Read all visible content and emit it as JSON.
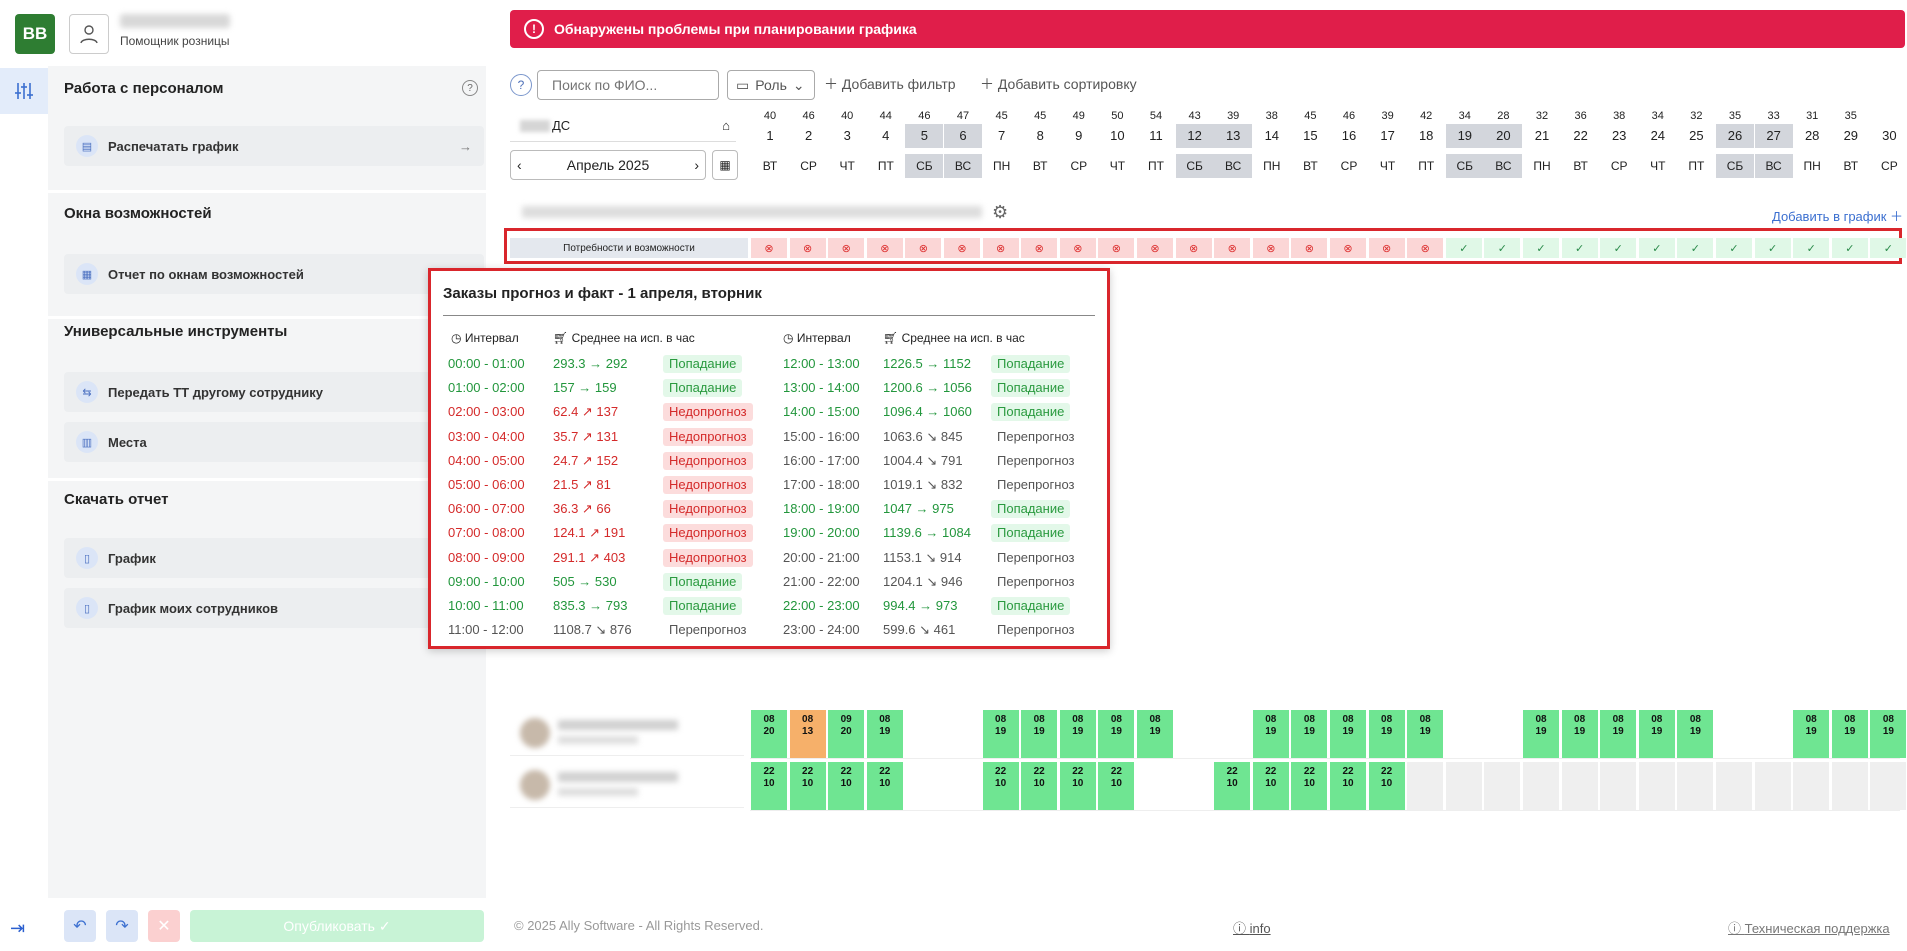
{
  "app": {
    "logo": "BB",
    "user_role": "Помощник розницы"
  },
  "alert": {
    "text": "Обнаружены проблемы при планировании графика"
  },
  "sidebar": {
    "sections": [
      {
        "title": "Работа с персоналом",
        "items": [
          "Распечатать график"
        ]
      },
      {
        "title": "Окна возможностей",
        "items": [
          "Отчет по окнам возможностей"
        ]
      },
      {
        "title": "Универсальные инструменты",
        "items": [
          "Передать ТТ другому сотруднику",
          "Места"
        ]
      },
      {
        "title": "Скачать отчет",
        "items": [
          "График",
          "График моих сотрудников"
        ]
      }
    ],
    "publish": "Опубликовать"
  },
  "toolbar": {
    "help": "?",
    "search_placeholder": "Поиск по ФИО...",
    "role": "Роль",
    "add_filter": "Добавить фильтр",
    "add_sort": "Добавить сортировку"
  },
  "store": {
    "suffix": "ДС"
  },
  "month": {
    "label": "Апрель 2025"
  },
  "grid": {
    "add_to_schedule": "Добавить в график",
    "needs_label": "Потребности и возможности",
    "day_numbers": [
      "40",
      "46",
      "40",
      "44",
      "46",
      "47",
      "45",
      "45",
      "49",
      "50",
      "54",
      "43",
      "39",
      "38",
      "45",
      "46",
      "39",
      "42",
      "34",
      "28",
      "32",
      "36",
      "38",
      "34",
      "32",
      "35",
      "33",
      "31",
      "35"
    ],
    "days": [
      "1",
      "2",
      "3",
      "4",
      "5",
      "6",
      "7",
      "8",
      "9",
      "10",
      "11",
      "12",
      "13",
      "14",
      "15",
      "16",
      "17",
      "18",
      "19",
      "20",
      "21",
      "22",
      "23",
      "24",
      "25",
      "26",
      "27",
      "28",
      "29",
      "30"
    ],
    "weekdays": [
      "ВТ",
      "СР",
      "ЧТ",
      "ПТ",
      "СБ",
      "ВС",
      "ПН",
      "ВТ",
      "СР",
      "ЧТ",
      "ПТ",
      "СБ",
      "ВС",
      "ПН",
      "ВТ",
      "СР",
      "ЧТ",
      "ПТ",
      "СБ",
      "ВС",
      "ПН",
      "ВТ",
      "СР",
      "ЧТ",
      "ПТ",
      "СБ",
      "ВС",
      "ПН",
      "ВТ",
      "СР"
    ],
    "weekend_idx": [
      4,
      5,
      11,
      12,
      18,
      19,
      25,
      26
    ],
    "needs_status": [
      "bad",
      "bad",
      "bad",
      "bad",
      "bad",
      "bad",
      "bad",
      "bad",
      "bad",
      "bad",
      "bad",
      "bad",
      "bad",
      "bad",
      "bad",
      "bad",
      "bad",
      "bad",
      "ok",
      "ok",
      "ok",
      "ok",
      "ok",
      "ok",
      "ok",
      "ok",
      "ok",
      "ok",
      "ok",
      "ok"
    ]
  },
  "popup": {
    "title": "Заказы прогноз и факт - 1 апреля, вторник",
    "col_interval": "Интервал",
    "col_avg": "Среднее на исп. в час",
    "left": [
      {
        "i": "00:00 - 01:00",
        "v": "293.3 → 292",
        "s": "Попадание",
        "t": "hit"
      },
      {
        "i": "01:00 - 02:00",
        "v": "157 → 159",
        "s": "Попадание",
        "t": "hit"
      },
      {
        "i": "02:00 - 03:00",
        "v": "62.4 ↗ 137",
        "s": "Недопрогноз",
        "t": "under"
      },
      {
        "i": "03:00 - 04:00",
        "v": "35.7 ↗ 131",
        "s": "Недопрогноз",
        "t": "under"
      },
      {
        "i": "04:00 - 05:00",
        "v": "24.7 ↗ 152",
        "s": "Недопрогноз",
        "t": "under"
      },
      {
        "i": "05:00 - 06:00",
        "v": "21.5 ↗ 81",
        "s": "Недопрогноз",
        "t": "under"
      },
      {
        "i": "06:00 - 07:00",
        "v": "36.3 ↗ 66",
        "s": "Недопрогноз",
        "t": "under"
      },
      {
        "i": "07:00 - 08:00",
        "v": "124.1 ↗ 191",
        "s": "Недопрогноз",
        "t": "under"
      },
      {
        "i": "08:00 - 09:00",
        "v": "291.1 ↗ 403",
        "s": "Недопрогноз",
        "t": "under"
      },
      {
        "i": "09:00 - 10:00",
        "v": "505 → 530",
        "s": "Попадание",
        "t": "hit"
      },
      {
        "i": "10:00 - 11:00",
        "v": "835.3 → 793",
        "s": "Попадание",
        "t": "hit"
      },
      {
        "i": "11:00 - 12:00",
        "v": "1108.7 ↘ 876",
        "s": "Перепрогноз",
        "t": "over"
      }
    ],
    "right": [
      {
        "i": "12:00 - 13:00",
        "v": "1226.5 → 1152",
        "s": "Попадание",
        "t": "hit"
      },
      {
        "i": "13:00 - 14:00",
        "v": "1200.6 → 1056",
        "s": "Попадание",
        "t": "hit"
      },
      {
        "i": "14:00 - 15:00",
        "v": "1096.4 → 1060",
        "s": "Попадание",
        "t": "hit"
      },
      {
        "i": "15:00 - 16:00",
        "v": "1063.6 ↘ 845",
        "s": "Перепрогноз",
        "t": "over"
      },
      {
        "i": "16:00 - 17:00",
        "v": "1004.4 ↘ 791",
        "s": "Перепрогноз",
        "t": "over"
      },
      {
        "i": "17:00 - 18:00",
        "v": "1019.1 ↘ 832",
        "s": "Перепрогноз",
        "t": "over"
      },
      {
        "i": "18:00 - 19:00",
        "v": "1047 → 975",
        "s": "Попадание",
        "t": "hit"
      },
      {
        "i": "19:00 - 20:00",
        "v": "1139.6 → 1084",
        "s": "Попадание",
        "t": "hit"
      },
      {
        "i": "20:00 - 21:00",
        "v": "1153.1 ↘ 914",
        "s": "Перепрогноз",
        "t": "over"
      },
      {
        "i": "21:00 - 22:00",
        "v": "1204.1 ↘ 946",
        "s": "Перепрогноз",
        "t": "over"
      },
      {
        "i": "22:00 - 23:00",
        "v": "994.4 → 973",
        "s": "Попадание",
        "t": "hit"
      },
      {
        "i": "23:00 - 24:00",
        "v": "599.6 ↘ 461",
        "s": "Перепрогноз",
        "t": "over"
      }
    ]
  },
  "schedule": {
    "rows": [
      {
        "cells": [
          [
            "08",
            "20",
            "g"
          ],
          [
            "08",
            "13",
            "o"
          ],
          [
            "09",
            "20",
            "g"
          ],
          [
            "08",
            "19",
            "g"
          ],
          null,
          null,
          [
            "08",
            "19",
            "g"
          ],
          [
            "08",
            "19",
            "g"
          ],
          [
            "08",
            "19",
            "g"
          ],
          [
            "08",
            "19",
            "g"
          ],
          [
            "08",
            "19",
            "g"
          ],
          null,
          null,
          [
            "08",
            "19",
            "g"
          ],
          [
            "08",
            "19",
            "g"
          ],
          [
            "08",
            "19",
            "g"
          ],
          [
            "08",
            "19",
            "g"
          ],
          [
            "08",
            "19",
            "g"
          ],
          null,
          null,
          [
            "08",
            "19",
            "g"
          ],
          [
            "08",
            "19",
            "g"
          ],
          [
            "08",
            "19",
            "g"
          ],
          [
            "08",
            "19",
            "g"
          ],
          [
            "08",
            "19",
            "g"
          ],
          null,
          null,
          [
            "08",
            "19",
            "g"
          ],
          [
            "08",
            "19",
            "g"
          ],
          [
            "08",
            "19",
            "g"
          ]
        ]
      },
      {
        "cells": [
          [
            "22",
            "10",
            "g"
          ],
          [
            "22",
            "10",
            "g"
          ],
          [
            "22",
            "10",
            "g"
          ],
          [
            "22",
            "10",
            "g"
          ],
          null,
          null,
          [
            "22",
            "10",
            "g"
          ],
          [
            "22",
            "10",
            "g"
          ],
          [
            "22",
            "10",
            "g"
          ],
          [
            "22",
            "10",
            "g"
          ],
          null,
          null,
          [
            "22",
            "10",
            "g"
          ],
          [
            "22",
            "10",
            "g"
          ],
          [
            "22",
            "10",
            "g"
          ],
          [
            "22",
            "10",
            "g"
          ],
          [
            "22",
            "10",
            "g"
          ],
          [
            "",
            "",
            "gr"
          ],
          [
            "",
            "",
            "gr"
          ],
          [
            "",
            "",
            "gr"
          ],
          [
            "",
            "",
            "gr"
          ],
          [
            "",
            "",
            "gr"
          ],
          [
            "",
            "",
            "gr"
          ],
          [
            "",
            "",
            "gr"
          ],
          [
            "",
            "",
            "gr"
          ],
          [
            "",
            "",
            "gr"
          ],
          [
            "",
            "",
            "gr"
          ],
          [
            "",
            "",
            "gr"
          ],
          [
            "",
            "",
            "gr"
          ],
          [
            "",
            "",
            "gr"
          ]
        ]
      }
    ]
  },
  "footer": {
    "copyright": "© 2025 Ally Software - All Rights Reserved.",
    "info": "info",
    "support": "Техническая поддержка"
  }
}
